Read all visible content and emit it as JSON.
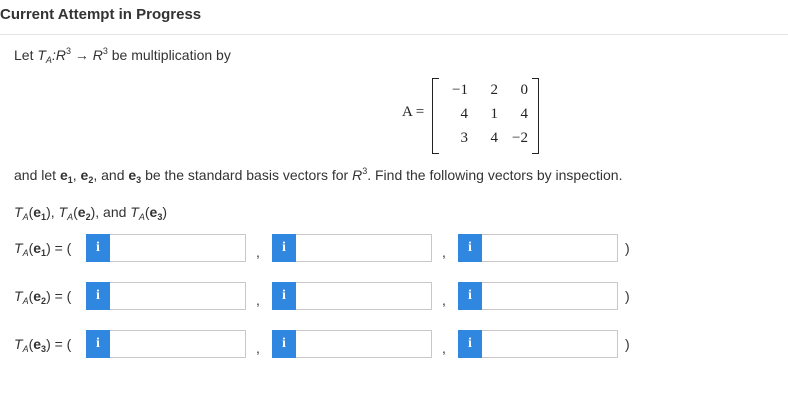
{
  "header": {
    "title": "Current Attempt in Progress"
  },
  "question": {
    "let": "Let",
    "T": "T",
    "A_sub": "A",
    "colon_R": ":R",
    "three": "3",
    "arrow": "→",
    "R": "R",
    "be_mult": "be multiplication by",
    "and_let": "and let",
    "e": "e",
    "sub1": "1",
    "sub2": "2",
    "sub3": "3",
    "comma": ",",
    "and_word": ", and",
    "be_std": "be the standard basis vectors for",
    "find": ". Find the following vectors by inspection."
  },
  "matrix": {
    "label": "A =",
    "rows": [
      [
        "−1",
        "2",
        "0"
      ],
      [
        "4",
        "1",
        "4"
      ],
      [
        "3",
        "4",
        "−2"
      ]
    ]
  },
  "targets_line": {
    "paren_open": "(",
    "paren_close": ")"
  },
  "answers": {
    "info_glyph": "i",
    "eq_paren": ") = (",
    "close": ")",
    "comma": ","
  }
}
